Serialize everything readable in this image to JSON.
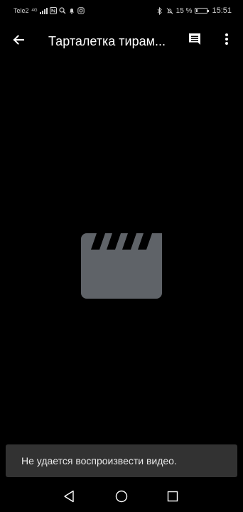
{
  "status_bar": {
    "carrier": "Tele2",
    "network_type_top": "4G",
    "network_type_bottom": "",
    "battery_percent": "15 %",
    "battery_level": 0.15,
    "time": "15:51",
    "icons": [
      "signal-icon",
      "nfc-icon",
      "search-icon",
      "notification-bell-icon",
      "instagram-icon",
      "bluetooth-icon",
      "mute-icon",
      "battery-icon"
    ]
  },
  "app_bar": {
    "title": "Тарталетка тирам...",
    "back_icon": "arrow-back-icon",
    "comments_icon": "comment-icon",
    "more_icon": "more-vert-icon"
  },
  "video": {
    "placeholder_icon": "clapperboard-icon"
  },
  "snackbar": {
    "message": "Не удается воспроизвести видео."
  },
  "nav_bar": {
    "icons": [
      "nav-back-icon",
      "nav-home-icon",
      "nav-recents-icon"
    ]
  },
  "colors": {
    "background": "#000000",
    "placeholder_icon": "#5f6368",
    "snackbar_bg": "#323232",
    "text_primary": "#ffffff"
  }
}
